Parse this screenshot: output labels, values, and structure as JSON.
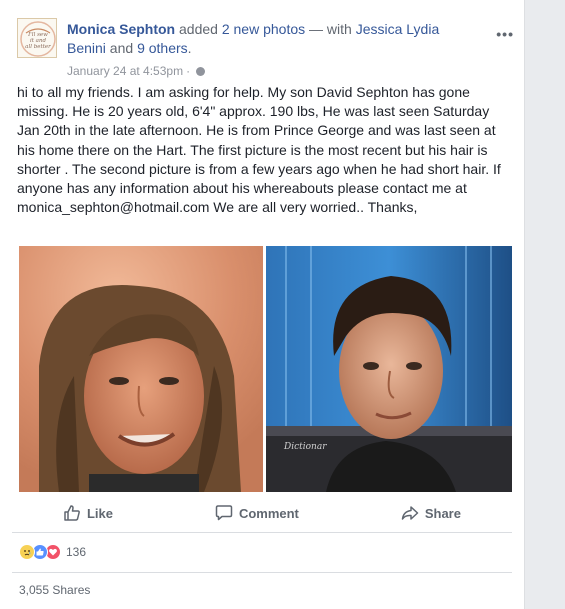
{
  "post": {
    "author": "Monica Sephton",
    "verb": " added ",
    "photos_link": "2 new photos",
    "with_text": " — with ",
    "tagged_person": "Jessica Lydia Benini",
    "and_text": " and ",
    "others_link": "9 others",
    "end_punct": ".",
    "timestamp": "January 24 at 4:53pm",
    "separator": "·",
    "more_label": "•••",
    "avatar_text": "I'll sew it and make it all better",
    "body": "hi to all my friends. I am asking for help. My son David Sephton has gone missing. He is 20 years old, 6'4\" approx. 190 lbs, He was last seen Saturday Jan 20th in the late afternoon. He is from Prince George and was last seen at his home there on the Hart. The first picture is the most recent but his hair is shorter . The second picture is from a few years ago when he had short hair. If anyone has any information about his whereabouts please contact me at monica_sephton@hotmail.com We are all very worried.. Thanks,",
    "photo2_caption": "Dictionar"
  },
  "actions": {
    "like": "Like",
    "comment": "Comment",
    "share": "Share"
  },
  "reactions": {
    "types": [
      "sad",
      "like",
      "love"
    ],
    "count": "136"
  },
  "shares": {
    "label": "3,055 Shares"
  },
  "colors": {
    "link": "#365899",
    "meta": "#90949c",
    "action": "#606770"
  }
}
